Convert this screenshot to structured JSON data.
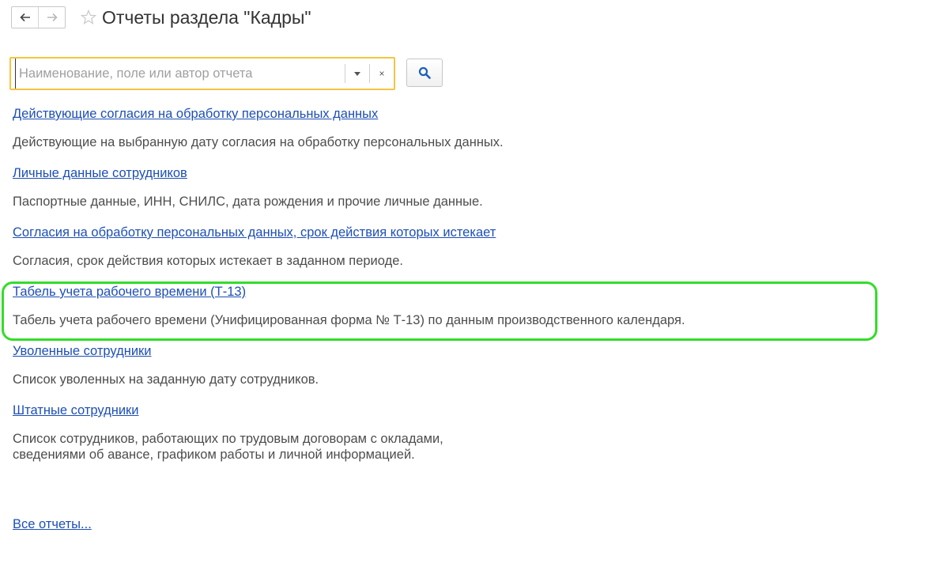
{
  "header": {
    "title": "Отчеты раздела \"Кадры\""
  },
  "search": {
    "placeholder": "Наименование, поле или автор отчета",
    "value": "",
    "clear_symbol": "×"
  },
  "reports": [
    {
      "title": "Действующие согласия на обработку персональных данных",
      "description": "Действующие на выбранную дату согласия на обработку персональных данных."
    },
    {
      "title": "Личные данные сотрудников",
      "description": "Паспортные данные, ИНН, СНИЛС, дата рождения и прочие личные данные."
    },
    {
      "title": "Согласия на обработку персональных данных, срок действия которых истекает",
      "description": "Согласия, срок действия которых истекает в заданном периоде."
    },
    {
      "title": "Табель учета рабочего времени (Т-13)",
      "description": "Табель учета рабочего времени (Унифицированная форма № Т-13) по данным производственного календаря.",
      "highlighted": true
    },
    {
      "title": "Уволенные сотрудники",
      "description": "Список уволенных на заданную дату сотрудников."
    },
    {
      "title": "Штатные сотрудники",
      "description_lines": [
        "Список сотрудников, работающих по трудовым договорам с окладами,",
        "сведениями об авансе, графиком работы и личной информацией."
      ]
    }
  ],
  "all_reports_link": "Все отчеты...",
  "colors": {
    "link": "#1d4fb5",
    "search_focus_border": "#f4c542",
    "highlight_border": "#33dd2a"
  },
  "icons": {
    "back": "arrow-left-icon",
    "forward": "arrow-right-icon",
    "favorite": "star-outline-icon",
    "dropdown": "triangle-down-icon",
    "clear": "close-icon",
    "search": "magnifier-icon"
  }
}
